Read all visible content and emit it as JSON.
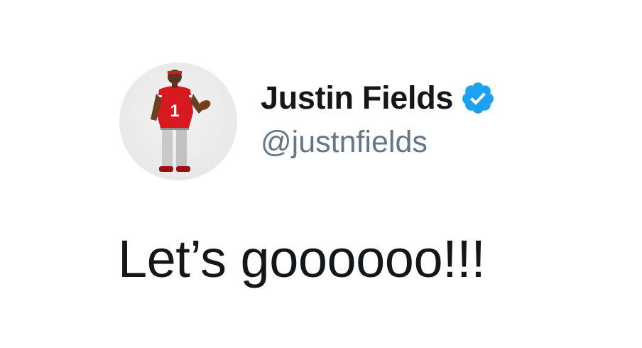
{
  "tweet": {
    "author": {
      "display_name": "Justin Fields",
      "handle": "@justnfields",
      "verified": true,
      "avatar_icon": "profile-photo",
      "verified_icon": "verified-badge-icon"
    },
    "text": "Let’s goooooo!!!"
  },
  "colors": {
    "name": "#14171a",
    "handle": "#657786",
    "verified": "#1da1f2",
    "background": "#ffffff"
  }
}
